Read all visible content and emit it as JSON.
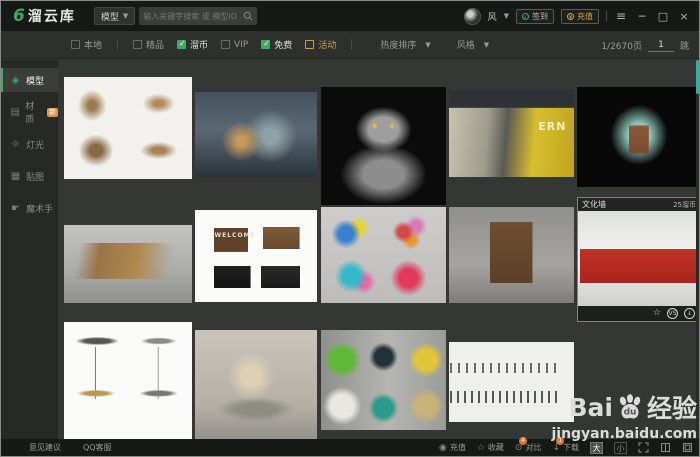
{
  "titlebar": {
    "logo_mark": "6",
    "logo_text": "溜云库",
    "category": "模型",
    "search_placeholder": "输入关键字搜索 或 模型ID",
    "username": "风",
    "checkin_label": "签到",
    "recharge_label": "充值"
  },
  "filterbar": {
    "filters": [
      {
        "key": "local",
        "label": "本地",
        "state": "unchecked",
        "divider_after": true
      },
      {
        "key": "boutique",
        "label": "精品",
        "state": "unchecked",
        "divider_after": false
      },
      {
        "key": "coin",
        "label": "溜币",
        "state": "checked",
        "divider_after": false
      },
      {
        "key": "vip",
        "label": "VIP",
        "state": "unchecked",
        "divider_after": false
      },
      {
        "key": "free",
        "label": "免费",
        "state": "checked",
        "divider_after": false
      },
      {
        "key": "activity",
        "label": "活动",
        "state": "activity",
        "divider_after": true
      }
    ],
    "sort_label": "热度排序",
    "style_label": "风格",
    "page_info": "1/2670页",
    "page_input": "1",
    "jump_label": "跳"
  },
  "sidebar": {
    "items": [
      {
        "key": "model",
        "label": "模型",
        "icon": "cube-icon",
        "glyph": "◈",
        "active": true,
        "badge": ""
      },
      {
        "key": "material",
        "label": "材质",
        "icon": "texture-icon",
        "glyph": "▤",
        "active": false,
        "badge": "新"
      },
      {
        "key": "light",
        "label": "灯光",
        "icon": "bulb-icon",
        "glyph": "☼",
        "active": false,
        "badge": ""
      },
      {
        "key": "map",
        "label": "贴图",
        "icon": "image-icon",
        "glyph": "▦",
        "active": false,
        "badge": ""
      },
      {
        "key": "magic-hand",
        "label": "魔术手",
        "icon": "hand-icon",
        "glyph": "☛",
        "active": false,
        "badge": ""
      }
    ]
  },
  "grid": {
    "tiles": [
      {
        "key": "wallart"
      },
      {
        "key": "shop"
      },
      {
        "key": "cat"
      },
      {
        "key": "office",
        "text": "ERN"
      },
      {
        "key": "arch"
      },
      {
        "key": "pergola"
      },
      {
        "key": "welcome",
        "text": "WELCOME"
      },
      {
        "key": "kids"
      },
      {
        "key": "cabinet"
      },
      {
        "key": "culture",
        "hover": true,
        "title": "文化墙",
        "price": "25溜币"
      },
      {
        "key": "tables"
      },
      {
        "key": "zen"
      },
      {
        "key": "signs"
      },
      {
        "key": "people"
      }
    ]
  },
  "statusbar": {
    "feedback_label": "意见建议",
    "qq_label": "QQ客服",
    "recharge_label": "充值",
    "favorite_label": "收藏",
    "compare_label": "对比",
    "compare_badge": "4",
    "download_label": "下载",
    "download_badge": "1",
    "size_large": "大",
    "size_small": "小"
  },
  "watermark": {
    "brand_prefix": "Bai",
    "brand_suffix": "经验",
    "url": "jingyan.baidu.com"
  },
  "colors": {
    "accent_green": "#3aad62",
    "accent_orange": "#e0973a",
    "badge_orange": "#e0762a",
    "titlebar_bg": "#161916",
    "grid_bg": "#343734"
  }
}
